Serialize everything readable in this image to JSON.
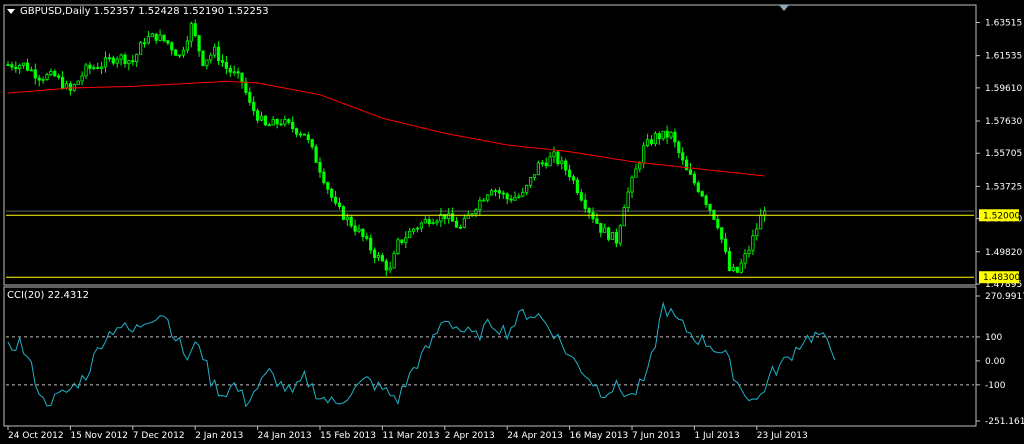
{
  "colors": {
    "background": "#000000",
    "frame": "#c0c0c0",
    "bull": "#00ff00",
    "ma": "#ff0000",
    "support": "#ffff00",
    "cci": "#20b2c8",
    "level_lines": "#c0c0c0",
    "label_box": "#ffff00",
    "bid_line": "#a0a0a0"
  },
  "header": {
    "main": "GBPUSD,Daily  1.52357 1.52428 1.52190 1.52253",
    "cci": "CCI(20) 22.4312"
  },
  "chart_data": [
    {
      "type": "candlestick",
      "title": "GBPUSD,Daily",
      "ylim": [
        1.47895,
        1.645
      ],
      "y_ticks": [
        "1.63515",
        "1.61535",
        "1.59610",
        "1.57630",
        "1.55705",
        "1.53725",
        "1.51800",
        "1.49820",
        "1.47895"
      ],
      "y_tick_values": [
        1.63515,
        1.61535,
        1.5961,
        1.5763,
        1.55705,
        1.53725,
        1.518,
        1.4982,
        1.47895
      ],
      "current_price": 1.52253,
      "x_tick_labels": [
        "24 Oct 2012",
        "15 Nov 2012",
        "7 Dec 2012",
        "2 Jan 2013",
        "24 Jan 2013",
        "15 Feb 2013",
        "11 Mar 2013",
        "2 Apr 2013",
        "24 Apr 2013",
        "16 May 2013",
        "7 Jun 2013",
        "1 Jul 2013",
        "23 Jul 2013"
      ],
      "x_tick_index": [
        0,
        16,
        32,
        48,
        64,
        80,
        96,
        112,
        128,
        144,
        160,
        176,
        192
      ],
      "bar_count": 195,
      "horizontal_levels": [
        {
          "value": 1.52,
          "label": "1.52000"
        },
        {
          "value": 1.483,
          "label": "1.48300"
        }
      ],
      "close_anchors": [
        [
          0,
          1.61
        ],
        [
          4,
          1.61
        ],
        [
          8,
          1.603
        ],
        [
          12,
          1.603
        ],
        [
          16,
          1.594
        ],
        [
          20,
          1.607
        ],
        [
          24,
          1.61
        ],
        [
          28,
          1.615
        ],
        [
          32,
          1.612
        ],
        [
          35,
          1.625
        ],
        [
          38,
          1.627
        ],
        [
          41,
          1.623
        ],
        [
          44,
          1.615
        ],
        [
          47,
          1.633
        ],
        [
          50,
          1.612
        ],
        [
          53,
          1.618
        ],
        [
          56,
          1.608
        ],
        [
          60,
          1.6
        ],
        [
          62,
          1.586
        ],
        [
          66,
          1.573
        ],
        [
          70,
          1.576
        ],
        [
          74,
          1.571
        ],
        [
          76,
          1.569
        ],
        [
          80,
          1.548
        ],
        [
          84,
          1.525
        ],
        [
          86,
          1.52
        ],
        [
          90,
          1.51
        ],
        [
          94,
          1.497
        ],
        [
          98,
          1.487
        ],
        [
          100,
          1.503
        ],
        [
          104,
          1.512
        ],
        [
          108,
          1.518
        ],
        [
          112,
          1.52
        ],
        [
          116,
          1.512
        ],
        [
          120,
          1.526
        ],
        [
          124,
          1.537
        ],
        [
          128,
          1.53
        ],
        [
          132,
          1.532
        ],
        [
          136,
          1.55
        ],
        [
          140,
          1.555
        ],
        [
          144,
          1.545
        ],
        [
          148,
          1.527
        ],
        [
          152,
          1.512
        ],
        [
          156,
          1.505
        ],
        [
          158,
          1.527
        ],
        [
          160,
          1.54
        ],
        [
          163,
          1.56
        ],
        [
          166,
          1.567
        ],
        [
          170,
          1.568
        ],
        [
          174,
          1.546
        ],
        [
          178,
          1.533
        ],
        [
          182,
          1.515
        ],
        [
          185,
          1.487
        ],
        [
          187,
          1.486
        ],
        [
          190,
          1.5
        ],
        [
          194,
          1.525
        ],
        [
          197,
          1.533
        ],
        [
          200,
          1.54
        ],
        [
          204,
          1.523
        ]
      ],
      "ma_anchors": [
        [
          0,
          1.593
        ],
        [
          16,
          1.596
        ],
        [
          32,
          1.597
        ],
        [
          48,
          1.599
        ],
        [
          56,
          1.6
        ],
        [
          64,
          1.599
        ],
        [
          80,
          1.592
        ],
        [
          96,
          1.578
        ],
        [
          112,
          1.569
        ],
        [
          128,
          1.562
        ],
        [
          144,
          1.558
        ],
        [
          160,
          1.552
        ],
        [
          176,
          1.548
        ],
        [
          192,
          1.544
        ],
        [
          204,
          1.541
        ]
      ]
    },
    {
      "type": "line",
      "title": "CCI(20) 22.4312",
      "ylim": [
        -251.1611,
        270.9917
      ],
      "y_ticks": [
        "270.9917",
        "100",
        "0.00",
        "-100",
        "-251.1611"
      ],
      "y_tick_values": [
        270.9917,
        100,
        0,
        -100,
        -251.1611
      ],
      "levels": [
        100,
        -100
      ],
      "current_value": 22.4312,
      "value_anchors": [
        [
          0,
          50
        ],
        [
          3,
          80
        ],
        [
          6,
          -30
        ],
        [
          9,
          -170
        ],
        [
          12,
          -160
        ],
        [
          16,
          -120
        ],
        [
          20,
          -60
        ],
        [
          24,
          80
        ],
        [
          28,
          150
        ],
        [
          32,
          120
        ],
        [
          36,
          180
        ],
        [
          40,
          200
        ],
        [
          43,
          100
        ],
        [
          46,
          10
        ],
        [
          49,
          80
        ],
        [
          52,
          -80
        ],
        [
          55,
          -140
        ],
        [
          58,
          -100
        ],
        [
          61,
          -170
        ],
        [
          64,
          -110
        ],
        [
          67,
          -50
        ],
        [
          70,
          -100
        ],
        [
          73,
          -140
        ],
        [
          76,
          -70
        ],
        [
          80,
          -150
        ],
        [
          84,
          -180
        ],
        [
          88,
          -130
        ],
        [
          92,
          -80
        ],
        [
          96,
          -120
        ],
        [
          100,
          -160
        ],
        [
          104,
          -30
        ],
        [
          108,
          60
        ],
        [
          112,
          180
        ],
        [
          116,
          130
        ],
        [
          120,
          100
        ],
        [
          124,
          160
        ],
        [
          128,
          120
        ],
        [
          132,
          200
        ],
        [
          136,
          190
        ],
        [
          140,
          120
        ],
        [
          144,
          20
        ],
        [
          148,
          -50
        ],
        [
          152,
          -130
        ],
        [
          156,
          -110
        ],
        [
          160,
          -150
        ],
        [
          164,
          -60
        ],
        [
          166,
          80
        ],
        [
          168,
          230
        ],
        [
          172,
          160
        ],
        [
          176,
          100
        ],
        [
          180,
          70
        ],
        [
          184,
          20
        ],
        [
          188,
          -120
        ],
        [
          192,
          -170
        ],
        [
          196,
          -50
        ],
        [
          200,
          10
        ],
        [
          204,
          90
        ],
        [
          208,
          110
        ],
        [
          212,
          30
        ]
      ]
    }
  ]
}
